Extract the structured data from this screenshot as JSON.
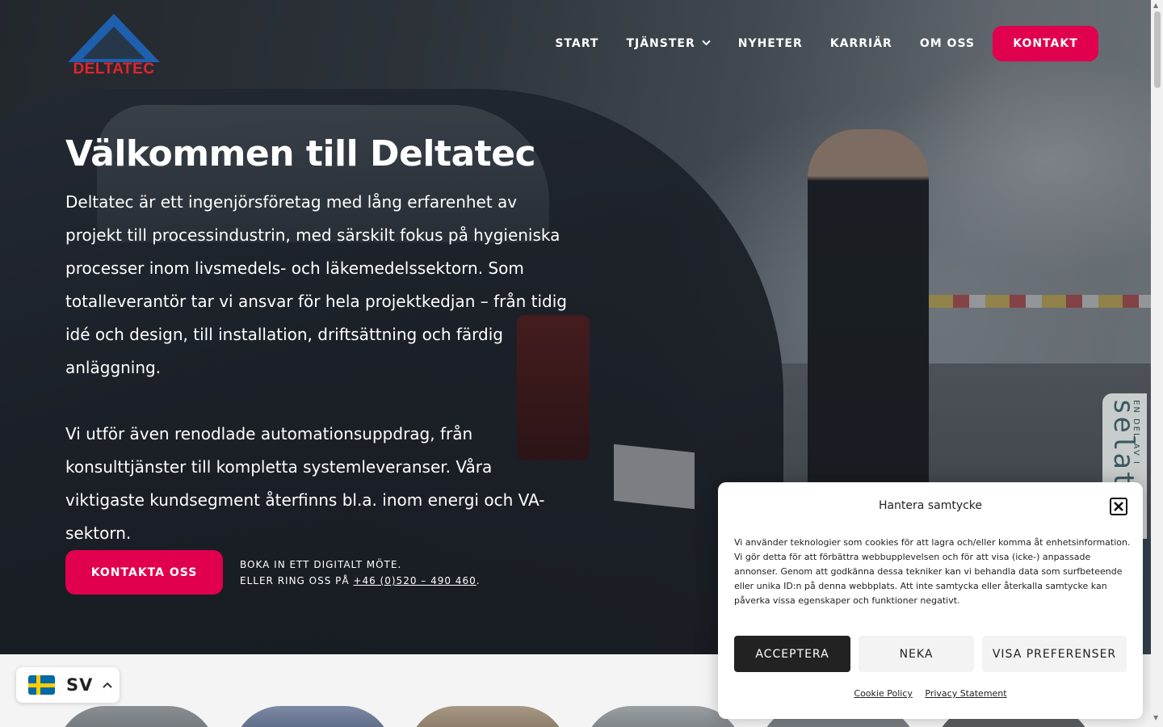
{
  "brand": {
    "logo_text": "DELTATEC",
    "colors": {
      "accent": "#e0004d",
      "logo_red": "#e3242b",
      "logo_blue": "#1e5fae"
    }
  },
  "nav": {
    "items": [
      {
        "label": "START",
        "has_dropdown": false
      },
      {
        "label": "TJÄNSTER",
        "has_dropdown": true,
        "icon": "chevron-down-icon"
      },
      {
        "label": "NYHETER",
        "has_dropdown": false
      },
      {
        "label": "KARRIÄR",
        "has_dropdown": false
      },
      {
        "label": "OM OSS",
        "has_dropdown": false
      }
    ],
    "cta_label": "KONTAKT"
  },
  "hero": {
    "title": "Välkommen till Deltatec",
    "paragraph1": "Deltatec är ett ingenjörsföretag med lång erfarenhet av projekt till processindustrin, med särskilt fokus på hygieniska processer inom livsmedels- och läkemedelssektorn. Som totalleverantör tar vi ansvar för hela projektkedjan – från tidig idé och design, till installation, driftsättning och färdig anläggning.",
    "paragraph2": "Vi utför även renodlade automationsuppdrag, från konsulttjänster till kompletta systemleveranser. Våra viktigaste kundsegment återfinns bl.a. inom energi och VA-sektorn.",
    "cta_label": "KONTAKTA OSS",
    "side_line1": "BOKA IN ETT DIGITALT MÖTE.",
    "side_line2_prefix": "ELLER RING OSS PÅ ",
    "phone": "+46 (0)520 – 490 460",
    "side_line2_suffix": "."
  },
  "side_badge": {
    "small_text": "EN DEL AV I",
    "big_text": "selat"
  },
  "language": {
    "code": "SV",
    "flag_icon": "sweden-flag-icon",
    "caret_icon": "chevron-up-icon"
  },
  "cookie": {
    "title": "Hantera samtycke",
    "close_icon": "close-icon",
    "body": "Vi använder teknologier som cookies för att lagra och/eller komma åt enhetsinformation. Vi gör detta för att förbättra webbupplevelsen och för att visa (icke-) anpassade annonser. Genom att godkänna dessa tekniker kan vi behandla data som surfbeteende eller unika ID:n på denna webbplats. Att inte samtycka eller återkalla samtycke kan påverka vissa egenskaper och funktioner negativt.",
    "accept_label": "ACCEPTERA",
    "deny_label": "NEKA",
    "prefs_label": "VISA PREFERENSER",
    "cookie_policy_label": "Cookie Policy",
    "privacy_label": "Privacy Statement"
  }
}
